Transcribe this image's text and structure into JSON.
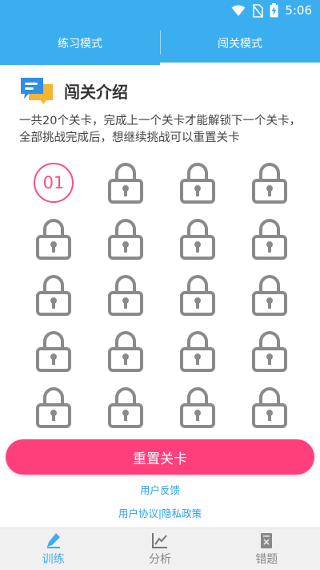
{
  "status_bar": {
    "time": "5:06"
  },
  "tabs": [
    {
      "label": "练习模式",
      "active": false
    },
    {
      "label": "闯关模式",
      "active": true
    }
  ],
  "intro": {
    "title": "闯关介绍",
    "description": "一共20个关卡，完成上一个关卡才能解锁下一个关卡，全部挑战完成后，想继续挑战可以重置关卡"
  },
  "levels": {
    "unlocked_label": "01",
    "total": 20,
    "locked_icon": "lock-icon"
  },
  "reset_button": {
    "label": "重置关卡"
  },
  "links": {
    "feedback": "用户反馈",
    "policy": "用户协议|隐私政策"
  },
  "bottom_nav": [
    {
      "label": "训练",
      "icon": "pencil-icon",
      "active": true
    },
    {
      "label": "分析",
      "icon": "chart-icon",
      "active": false
    },
    {
      "label": "错题",
      "icon": "document-icon",
      "active": false
    }
  ],
  "colors": {
    "primary": "#3baef0",
    "accent": "#ff3f7c",
    "lock": "#8a8a8a"
  }
}
